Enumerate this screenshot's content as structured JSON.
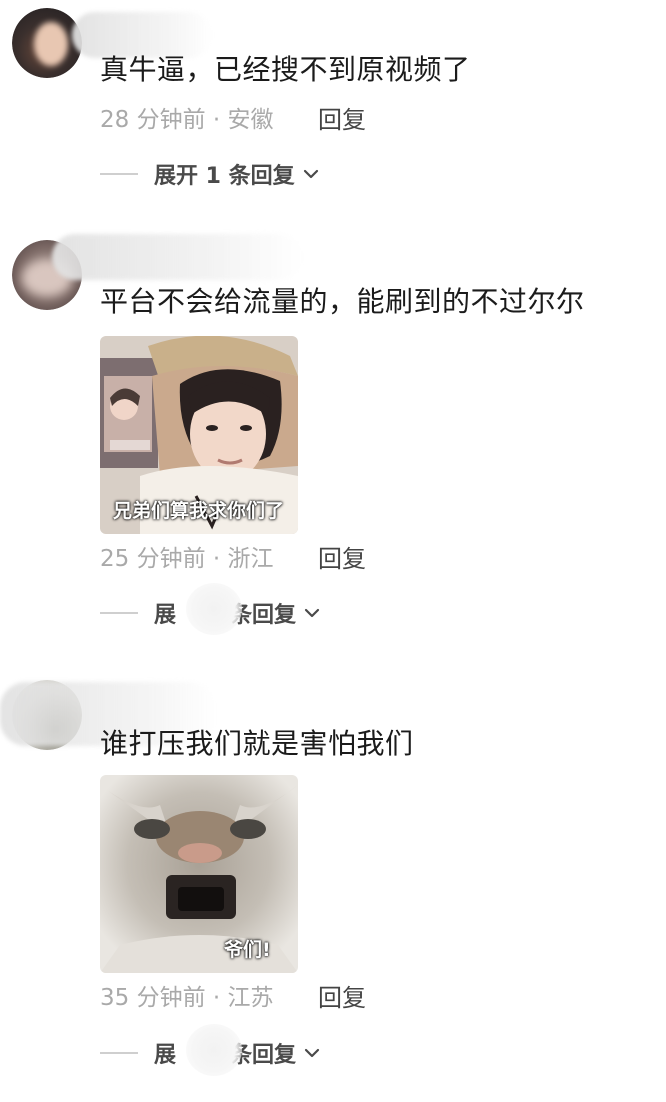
{
  "comments": [
    {
      "text": "真牛逼，已经搜不到原视频了",
      "time": "28 分钟前",
      "location": "安徽",
      "reply_label": "回复",
      "expand_label": "展开 1 条回复"
    },
    {
      "text": "平台不会给流量的，能刷到的不过尔尔",
      "sticker_caption": "兄弟们算我求你们了",
      "time": "25 分钟前",
      "location": "浙江",
      "reply_label": "回复",
      "expand_label_start": "展",
      "expand_label_end": "条回复"
    },
    {
      "text": "谁打压我们就是害怕我们",
      "sticker_caption": "爷们!",
      "time": "35 分钟前",
      "location": "江苏",
      "reply_label": "回复",
      "expand_label_start": "展",
      "expand_label_end": "条回复"
    }
  ],
  "icons": {
    "chevron": "chevron-down-icon"
  },
  "colors": {
    "text": "#1b1b1b",
    "meta": "#a9a9a9",
    "reply": "#444444"
  }
}
